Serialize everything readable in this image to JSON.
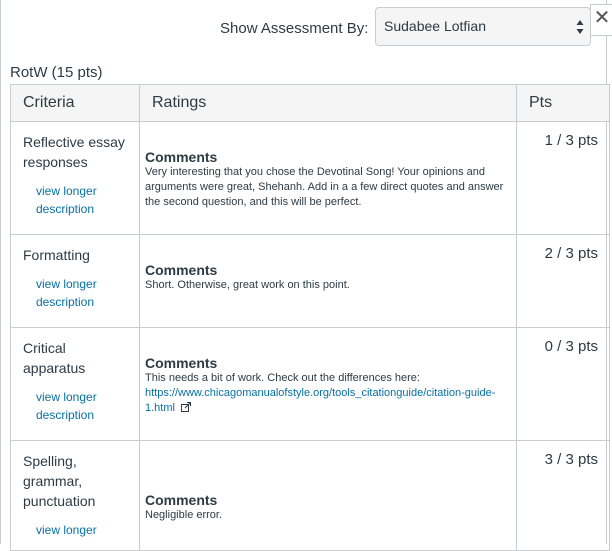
{
  "header": {
    "show_by_label": "Show Assessment By:",
    "selected_student": "Sudabee Lotfian",
    "close_glyph": "✕"
  },
  "rubric": {
    "title": "RotW (15 pts)",
    "columns": {
      "criteria": "Criteria",
      "ratings": "Ratings",
      "pts": "Pts"
    },
    "rows": [
      {
        "criterion": "Reflective essay responses",
        "link": "view longer description",
        "comments_heading": "Comments",
        "comments": "Very interesting that you chose the Devotinal Song! Your opinions and arguments were great, Shehanh. Add in a a few direct quotes and answer the second question, and this will be perfect.",
        "points": "1 / 3 pts"
      },
      {
        "criterion": "Formatting",
        "link": "view longer description",
        "comments_heading": "Comments",
        "comments": "Short. Otherwise, great work on this point.",
        "points": "2 / 3 pts"
      },
      {
        "criterion": "Critical apparatus",
        "link": "view longer description",
        "comments_heading": "Comments",
        "comments": "This needs a bit of work. Check out the differences here:",
        "comments_url": "https://www.chicagomanualofstyle.org/tools_citationguide/citation-guide-1.html",
        "points": "0 / 3 pts"
      },
      {
        "criterion": "Spelling, grammar, punctuation",
        "link": "view longer",
        "comments_heading": "Comments",
        "comments": "Negligible error.",
        "points": "3 / 3 pts"
      }
    ]
  },
  "icons": {
    "close": "close-icon",
    "select_arrows": "select-arrows-icon",
    "external_link": "external-link-icon"
  }
}
